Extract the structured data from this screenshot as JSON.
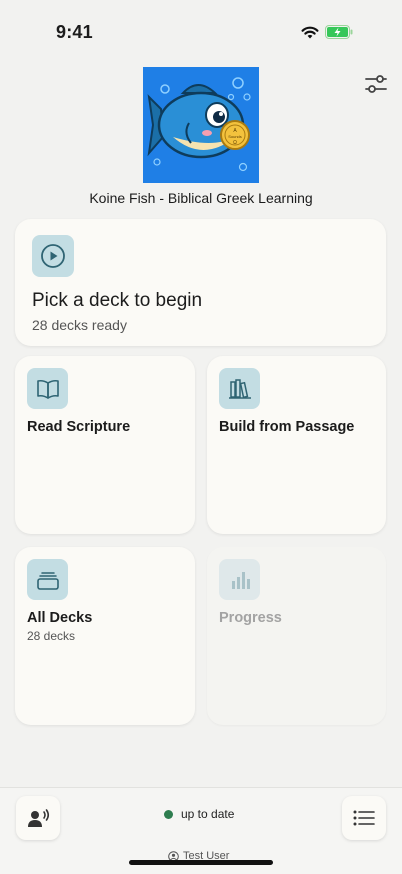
{
  "status_bar": {
    "time": "9:41"
  },
  "app": {
    "title": "Koine Fish - Biblical Greek Learning",
    "logo_coin_text": "A Sounds Ω"
  },
  "hero": {
    "title": "Pick a deck to begin",
    "subtitle": "28 decks ready",
    "icon": "play-circle-icon"
  },
  "tiles": [
    {
      "label": "Read Scripture",
      "icon": "open-book-icon"
    },
    {
      "label": "Build from Passage",
      "icon": "bookshelf-icon"
    },
    {
      "label": "All Decks",
      "sublabel": "28 decks",
      "icon": "stack-icon"
    },
    {
      "label": "Progress",
      "icon": "bar-chart-icon",
      "disabled": true
    }
  ],
  "footer": {
    "sync_status": "up to date",
    "user": "Test User"
  },
  "colors": {
    "background": "#f2f2f0",
    "card": "#fbfaf6",
    "icon_tile": "#c3dde3",
    "icon_stroke": "#2f6473",
    "sync_ok": "#2e7d4f"
  }
}
